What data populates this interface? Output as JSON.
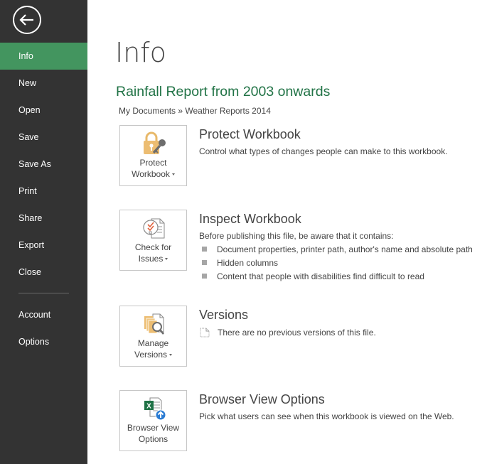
{
  "sidebar": {
    "back_icon": "back-arrow-circle-icon",
    "items": [
      {
        "label": "Info",
        "active": true
      },
      {
        "label": "New"
      },
      {
        "label": "Open"
      },
      {
        "label": "Save"
      },
      {
        "label": "Save As"
      },
      {
        "label": "Print"
      },
      {
        "label": "Share"
      },
      {
        "label": "Export"
      },
      {
        "label": "Close"
      },
      {
        "label": "Account"
      },
      {
        "label": "Options"
      }
    ],
    "colors": {
      "background": "#333333",
      "active": "#43955f"
    }
  },
  "main": {
    "page_title": "Info",
    "document_title": "Rainfall Report from 2003 onwards",
    "breadcrumb": "My Documents » Weather Reports 2014",
    "accent_color": "#217346",
    "sections": {
      "protect": {
        "button_line1": "Protect",
        "button_line2": "Workbook",
        "icon": "lock-key-icon",
        "title": "Protect Workbook",
        "description": "Control what types of changes people can make to this workbook."
      },
      "inspect": {
        "button_line1": "Check for",
        "button_line2": "Issues",
        "icon": "check-document-icon",
        "title": "Inspect Workbook",
        "description": "Before publishing this file, be aware that it contains:",
        "bullets": [
          "Document properties, printer path, author's name and absolute path",
          "Hidden columns",
          "Content that people with disabilities find difficult to read"
        ]
      },
      "versions": {
        "button_line1": "Manage",
        "button_line2": "Versions",
        "icon": "manage-versions-icon",
        "title": "Versions",
        "description": "There are no previous versions of this file."
      },
      "browser": {
        "button_line1": "Browser View",
        "button_line2": "Options",
        "icon": "excel-browser-view-icon",
        "title": "Browser View Options",
        "description": "Pick what users can see when this workbook is viewed on the Web."
      }
    }
  }
}
